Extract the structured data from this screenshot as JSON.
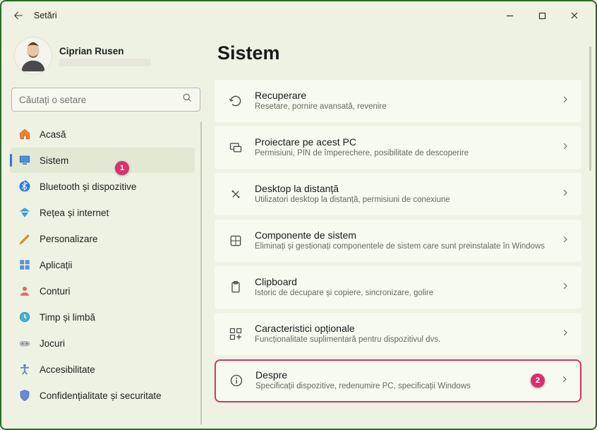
{
  "window": {
    "title": "Setări",
    "user_name": "Ciprian Rusen"
  },
  "search": {
    "placeholder": "Căutați o setare"
  },
  "nav": {
    "items": [
      {
        "id": "home",
        "label": "Acasă"
      },
      {
        "id": "system",
        "label": "Sistem",
        "selected": true
      },
      {
        "id": "bluetooth",
        "label": "Bluetooth și dispozitive"
      },
      {
        "id": "network",
        "label": "Rețea și internet"
      },
      {
        "id": "personal",
        "label": "Personalizare"
      },
      {
        "id": "apps",
        "label": "Aplicații"
      },
      {
        "id": "accounts",
        "label": "Conturi"
      },
      {
        "id": "time",
        "label": "Timp și limbă"
      },
      {
        "id": "gaming",
        "label": "Jocuri"
      },
      {
        "id": "access",
        "label": "Accesibilitate"
      },
      {
        "id": "privacy",
        "label": "Confidențialitate și securitate"
      }
    ]
  },
  "page": {
    "title": "Sistem",
    "cards": [
      {
        "id": "recovery",
        "title": "Recuperare",
        "desc": "Resetare, pornire avansată, revenire"
      },
      {
        "id": "project",
        "title": "Proiectare pe acest PC",
        "desc": "Permisiuni, PIN de împerechere, posibilitate de descoperire"
      },
      {
        "id": "rdp",
        "title": "Desktop la distanță",
        "desc": "Utilizatori desktop la distanță, permisiuni de conexiune"
      },
      {
        "id": "components",
        "title": "Componente de sistem",
        "desc": "Eliminați și gestionați componentele de sistem care sunt preinstalate în Windows"
      },
      {
        "id": "clipboard",
        "title": "Clipboard",
        "desc": "Istoric de decupare și copiere, sincronizare, golire"
      },
      {
        "id": "optional",
        "title": "Caracteristici opționale",
        "desc": "Funcționalitate suplimentară pentru dispozitivul dvs."
      },
      {
        "id": "about",
        "title": "Despre",
        "desc": "Specificații dispozitive, redenumire PC, specificații Windows",
        "highlighted": true
      }
    ]
  },
  "annotations": {
    "pin1": "1",
    "pin2": "2"
  },
  "icons": {
    "home": "<path d='M3 10.5 12 3l9 7.5V20a1 1 0 0 1-1 1h-5v-6H10v6H5a1 1 0 0 1-1-1z' fill='#f08030' stroke='#c05a1a'/>",
    "system": "<rect x='3' y='4' width='18' height='12' rx='1' fill='#4a90d9' stroke='#2a6ab0'/><rect x='8' y='18' width='8' height='2' fill='#2a6ab0'/>",
    "bluetooth": "<path d='M12 2v20l7-6-7-6 7-6-7-6zM12 12 5 6m0 12 7-6' stroke='#fff' fill='#2a7de1'/><circle cx='12' cy='12' r='10' fill='#2a7de1'/><path d='M11 5v14l5-4.2-5-4.6 5-4.2L11 5zM11 12 7 8m0 8 4-4' stroke='#fff' stroke-width='1.4' fill='none'/>",
    "network": "<path d='M12 3 2 10h20zM5 12l7 9 7-9z' fill='#3aa0e0'/>",
    "personal": "<path d='M4 19 18 5l2 2L6 21l-3 1z' fill='#e0a030' stroke='#b07010'/>",
    "apps": "<rect x='3' y='3' width='8' height='8' rx='1' fill='#5a8fd6'/><rect x='13' y='3' width='8' height='8' rx='1' fill='#5a8fd6'/><rect x='3' y='13' width='8' height='8' rx='1' fill='#5a8fd6'/><rect x='13' y='13' width='8' height='8' rx='1' fill='#5a8fd6'/>",
    "accounts": "<circle cx='12' cy='8' r='4' fill='#e06a6a'/><path d='M4 21c0-4 4-6 8-6s8 2 8 6' fill='#e06a6a'/>",
    "time": "<circle cx='12' cy='12' r='9' fill='#4ab0d0' stroke='#2a8ab0'/><path d='M12 7v5l3 2' stroke='#fff' stroke-width='2' fill='none'/>",
    "gaming": "<rect x='2' y='8' width='20' height='10' rx='5' fill='#b8b8c0'/><circle cx='8' cy='13' r='1.5' fill='#666'/><circle cx='16' cy='13' r='1.5' fill='#666'/>",
    "access": "<circle cx='12' cy='5' r='2.5' fill='#5a7ad6'/><path d='M5 9h14M12 9v7m-4 5 4-5 4 5' stroke='#5a7ad6' stroke-width='2.2' fill='none' stroke-linecap='round'/>",
    "privacy": "<path d='M12 2 4 5v6c0 5 3.5 9 8 11 4.5-2 8-6 8-11V5z' fill='#6a8ad6' stroke='#4a6ab6'/>",
    "recovery": "<path d='M4 12a8 8 0 1 1 2.5 5.8M4 12l-2-3m2 3 3-1' stroke='#444' stroke-width='1.6' fill='none' stroke-linecap='round'/>",
    "project": "<rect x='3' y='5' width='14' height='10' rx='1' stroke='#444' stroke-width='1.5' fill='none'/><rect x='9' y='10' width='12' height='9' rx='1' stroke='#444' stroke-width='1.5' fill='#f7faef'/>",
    "rdp": "<path d='M7 7l10 10M7 17 17 7' stroke='#444' stroke-width='1.6'/><circle cx='7' cy='7' r='1.5' fill='#444'/><circle cx='17' cy='17' r='1.5' fill='#444'/>",
    "components": "<rect x='4' y='4' width='16' height='16' rx='2' stroke='#444' stroke-width='1.5' fill='none'/><path d='M12 4v16M4 12h16' stroke='#444' stroke-width='1.2'/>",
    "clipboard": "<rect x='6' y='4' width='12' height='16' rx='1.5' stroke='#444' stroke-width='1.5' fill='none'/><rect x='9' y='2' width='6' height='4' rx='1' stroke='#444' stroke-width='1.5' fill='none'/>",
    "optional": "<rect x='3' y='3' width='7' height='7' stroke='#444' stroke-width='1.4' fill='none'/><rect x='14' y='3' width='7' height='7' stroke='#444' stroke-width='1.4' fill='none'/><rect x='3' y='14' width='7' height='7' stroke='#444' stroke-width='1.4' fill='none'/><path d='M17.5 13v8M13.5 17h8' stroke='#444' stroke-width='1.6'/>",
    "about": "<circle cx='12' cy='12' r='9' stroke='#444' stroke-width='1.6' fill='none'/><circle cx='12' cy='8' r='1.2' fill='#444'/><path d='M12 11v6' stroke='#444' stroke-width='1.8'/>"
  }
}
